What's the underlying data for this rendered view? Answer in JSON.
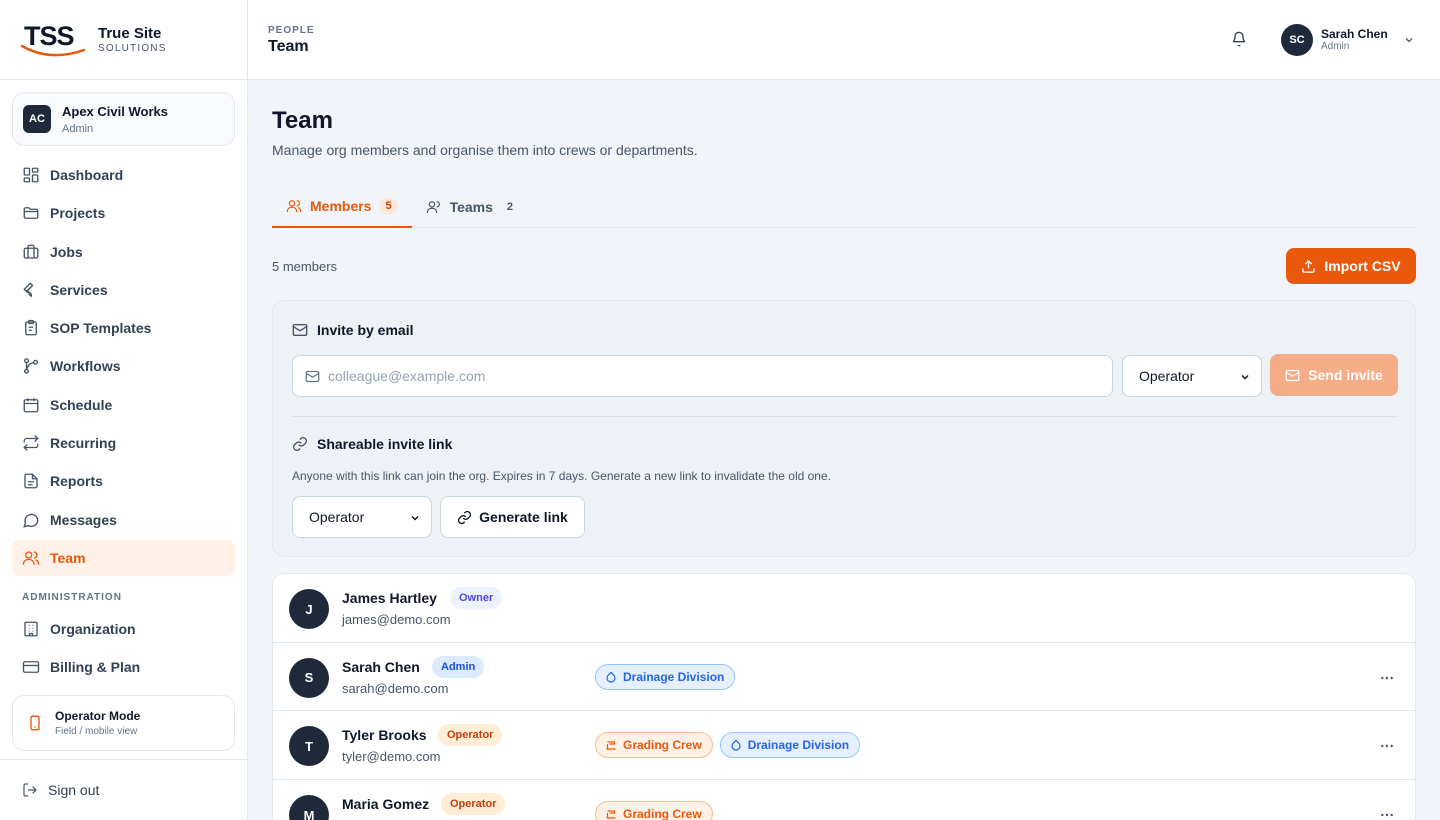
{
  "brand": {
    "logo_text": "TSS",
    "name": "True Site",
    "sub": "SOLUTIONS"
  },
  "org": {
    "initials": "AC",
    "name": "Apex Civil Works",
    "role": "Admin"
  },
  "nav": {
    "items": [
      {
        "label": "Dashboard",
        "icon": "grid-icon"
      },
      {
        "label": "Projects",
        "icon": "folder-icon"
      },
      {
        "label": "Jobs",
        "icon": "briefcase-icon"
      },
      {
        "label": "Services",
        "icon": "wrench-icon"
      },
      {
        "label": "SOP Templates",
        "icon": "clipboard-icon"
      },
      {
        "label": "Workflows",
        "icon": "workflow-icon"
      },
      {
        "label": "Schedule",
        "icon": "calendar-icon"
      },
      {
        "label": "Recurring",
        "icon": "repeat-icon"
      },
      {
        "label": "Reports",
        "icon": "file-icon"
      },
      {
        "label": "Messages",
        "icon": "chat-icon"
      },
      {
        "label": "Team",
        "icon": "users-icon",
        "active": true
      }
    ],
    "admin_section": "ADMINISTRATION",
    "admin_items": [
      {
        "label": "Organization",
        "icon": "building-icon"
      },
      {
        "label": "Billing & Plan",
        "icon": "credit-card-icon"
      }
    ]
  },
  "operator_mode": {
    "title": "Operator Mode",
    "sub": "Field / mobile view"
  },
  "signout": "Sign out",
  "topbar": {
    "crumb": "PEOPLE",
    "title": "Team",
    "user": {
      "initials": "SC",
      "name": "Sarah Chen",
      "role": "Admin"
    }
  },
  "page": {
    "title": "Team",
    "subtitle": "Manage org members and organise them into crews or departments.",
    "tabs": [
      {
        "label": "Members",
        "count": "5",
        "active": true
      },
      {
        "label": "Teams",
        "count": "2",
        "active": false
      }
    ],
    "member_count": "5 members",
    "import_label": "Import CSV"
  },
  "invite": {
    "email_heading": "Invite by email",
    "email_placeholder": "colleague@example.com",
    "role_value": "Operator",
    "send_label": "Send invite",
    "link_heading": "Shareable invite link",
    "link_desc": "Anyone with this link can join the org. Expires in 7 days. Generate a new link to invalidate the old one.",
    "link_role_value": "Operator",
    "generate_label": "Generate link"
  },
  "members": [
    {
      "initial": "J",
      "name": "James Hartley",
      "role": "Owner",
      "email": "james@demo.com",
      "chips": []
    },
    {
      "initial": "S",
      "name": "Sarah Chen",
      "role": "Admin",
      "email": "sarah@demo.com",
      "chips": [
        {
          "label": "Drainage Division",
          "kind": "division"
        }
      ]
    },
    {
      "initial": "T",
      "name": "Tyler Brooks",
      "role": "Operator",
      "email": "tyler@demo.com",
      "chips": [
        {
          "label": "Grading Crew",
          "kind": "crew"
        },
        {
          "label": "Drainage Division",
          "kind": "division"
        }
      ]
    },
    {
      "initial": "M",
      "name": "Maria Gomez",
      "role": "Operator",
      "email": "",
      "chips": [
        {
          "label": "Grading Crew",
          "kind": "crew"
        }
      ]
    }
  ],
  "colors": {
    "accent": "#ea580c",
    "sidebar_active_bg": "#fff1e8",
    "dark": "#1e293b"
  }
}
